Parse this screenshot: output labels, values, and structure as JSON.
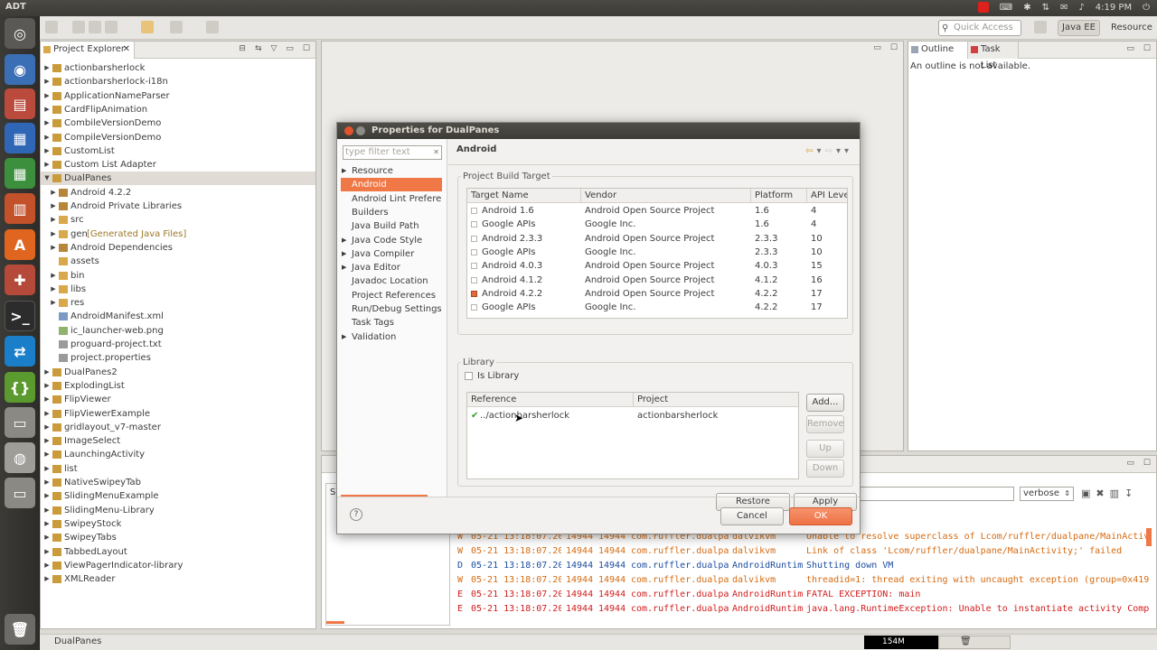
{
  "system": {
    "title": "ADT",
    "clock": "4:19 PM"
  },
  "toolbar": {
    "quick_access_placeholder": "Quick Access",
    "perspectives": [
      "Java EE",
      "Resource"
    ]
  },
  "project_explorer": {
    "title": "Project Explorer",
    "items": [
      {
        "label": "actionbarsherlock",
        "depth": 0,
        "expanded": false,
        "icon": "project-icon"
      },
      {
        "label": "actionbarsherlock-i18n",
        "depth": 0,
        "expanded": false,
        "icon": "project-icon"
      },
      {
        "label": "ApplicationNameParser",
        "depth": 0,
        "expanded": false,
        "icon": "project-icon"
      },
      {
        "label": "CardFlipAnimation",
        "depth": 0,
        "expanded": false,
        "icon": "project-icon"
      },
      {
        "label": "CombileVersionDemo",
        "depth": 0,
        "expanded": false,
        "icon": "project-icon"
      },
      {
        "label": "CompileVersionDemo",
        "depth": 0,
        "expanded": false,
        "icon": "project-icon"
      },
      {
        "label": "CustomList",
        "depth": 0,
        "expanded": false,
        "icon": "project-icon"
      },
      {
        "label": "Custom List Adapter",
        "depth": 0,
        "expanded": false,
        "icon": "project-icon"
      },
      {
        "label": "DualPanes",
        "depth": 0,
        "expanded": true,
        "icon": "project-icon",
        "selected": true
      },
      {
        "label": "Android 4.2.2",
        "depth": 1,
        "expanded": false,
        "icon": "library-icon"
      },
      {
        "label": "Android Private Libraries",
        "depth": 1,
        "expanded": false,
        "icon": "library-icon"
      },
      {
        "label": "src",
        "depth": 1,
        "expanded": false,
        "icon": "folder-icon"
      },
      {
        "label": "gen",
        "suffix": "[Generated Java Files]",
        "depth": 1,
        "expanded": false,
        "icon": "folder-icon"
      },
      {
        "label": "Android Dependencies",
        "depth": 1,
        "expanded": false,
        "icon": "library-icon"
      },
      {
        "label": "assets",
        "depth": 1,
        "expanded": null,
        "icon": "folder-icon"
      },
      {
        "label": "bin",
        "depth": 1,
        "expanded": false,
        "icon": "folder-icon"
      },
      {
        "label": "libs",
        "depth": 1,
        "expanded": false,
        "icon": "folder-icon"
      },
      {
        "label": "res",
        "depth": 1,
        "expanded": false,
        "icon": "folder-icon"
      },
      {
        "label": "AndroidManifest.xml",
        "depth": 1,
        "expanded": null,
        "icon": "xml-file-icon"
      },
      {
        "label": "ic_launcher-web.png",
        "depth": 1,
        "expanded": null,
        "icon": "image-file-icon"
      },
      {
        "label": "proguard-project.txt",
        "depth": 1,
        "expanded": null,
        "icon": "text-file-icon"
      },
      {
        "label": "project.properties",
        "depth": 1,
        "expanded": null,
        "icon": "text-file-icon"
      },
      {
        "label": "DualPanes2",
        "depth": 0,
        "expanded": false,
        "icon": "project-icon"
      },
      {
        "label": "ExplodingList",
        "depth": 0,
        "expanded": false,
        "icon": "project-icon"
      },
      {
        "label": "FlipViewer",
        "depth": 0,
        "expanded": false,
        "icon": "project-icon"
      },
      {
        "label": "FlipViewerExample",
        "depth": 0,
        "expanded": false,
        "icon": "project-icon"
      },
      {
        "label": "gridlayout_v7-master",
        "depth": 0,
        "expanded": false,
        "icon": "project-icon"
      },
      {
        "label": "ImageSelect",
        "depth": 0,
        "expanded": false,
        "icon": "project-icon"
      },
      {
        "label": "LaunchingActivity",
        "depth": 0,
        "expanded": false,
        "icon": "project-icon"
      },
      {
        "label": "list",
        "depth": 0,
        "expanded": false,
        "icon": "project-icon"
      },
      {
        "label": "NativeSwipeyTab",
        "depth": 0,
        "expanded": false,
        "icon": "project-icon"
      },
      {
        "label": "SlidingMenuExample",
        "depth": 0,
        "expanded": false,
        "icon": "project-icon"
      },
      {
        "label": "SlidingMenu-Library",
        "depth": 0,
        "expanded": false,
        "icon": "project-icon"
      },
      {
        "label": "SwipeyStock",
        "depth": 0,
        "expanded": false,
        "icon": "project-icon"
      },
      {
        "label": "SwipeyTabs",
        "depth": 0,
        "expanded": false,
        "icon": "project-icon"
      },
      {
        "label": "TabbedLayout",
        "depth": 0,
        "expanded": false,
        "icon": "project-icon"
      },
      {
        "label": "ViewPagerIndicator-library",
        "depth": 0,
        "expanded": false,
        "icon": "project-icon"
      },
      {
        "label": "XMLReader",
        "depth": 0,
        "expanded": false,
        "icon": "project-icon"
      }
    ]
  },
  "outline": {
    "tabs": [
      "Outline",
      "Task List"
    ],
    "message": "An outline is not available."
  },
  "logcat": {
    "level": "verbose",
    "rows": [
      {
        "level": "W",
        "time": "05-21 13:18:07.20",
        "pid": "14944",
        "tid": "14944",
        "app": "com.ruffler.dualpa",
        "tag": "dalvikvm",
        "text": "Unable to resolve superclass of Lcom/ruffler/dualpane/MainActiv"
      },
      {
        "level": "W",
        "time": "05-21 13:18:07.20",
        "pid": "14944",
        "tid": "14944",
        "app": "com.ruffler.dualpa",
        "tag": "dalvikvm",
        "text": "Link of class 'Lcom/ruffler/dualpane/MainActivity;' failed"
      },
      {
        "level": "D",
        "time": "05-21 13:18:07.20",
        "pid": "14944",
        "tid": "14944",
        "app": "com.ruffler.dualpa",
        "tag": "AndroidRuntim",
        "text": "Shutting down VM"
      },
      {
        "level": "W",
        "time": "05-21 13:18:07.20",
        "pid": "14944",
        "tid": "14944",
        "app": "com.ruffler.dualpa",
        "tag": "dalvikvm",
        "text": "threadid=1: thread exiting with uncaught exception (group=0x419"
      },
      {
        "level": "E",
        "time": "05-21 13:18:07.20",
        "pid": "14944",
        "tid": "14944",
        "app": "com.ruffler.dualpa",
        "tag": "AndroidRuntim",
        "text": "FATAL EXCEPTION: main"
      },
      {
        "level": "E",
        "time": "05-21 13:18:07.20",
        "pid": "14944",
        "tid": "14944",
        "app": "com.ruffler.dualpa",
        "tag": "AndroidRuntim",
        "text": "java.lang.RuntimeException: Unable to instantiate activity Comp"
      }
    ]
  },
  "status_bar": {
    "text": "DualPanes",
    "heap": "154M"
  },
  "dialog": {
    "title": "Properties for DualPanes",
    "filter_placeholder": "type filter text",
    "categories": [
      {
        "label": "Resource",
        "expandable": true
      },
      {
        "label": "Android",
        "expandable": false,
        "selected": true
      },
      {
        "label": "Android Lint Preferences",
        "expandable": false
      },
      {
        "label": "Builders",
        "expandable": false
      },
      {
        "label": "Java Build Path",
        "expandable": false
      },
      {
        "label": "Java Code Style",
        "expandable": true
      },
      {
        "label": "Java Compiler",
        "expandable": true
      },
      {
        "label": "Java Editor",
        "expandable": true
      },
      {
        "label": "Javadoc Location",
        "expandable": false
      },
      {
        "label": "Project References",
        "expandable": false
      },
      {
        "label": "Run/Debug Settings",
        "expandable": false
      },
      {
        "label": "Task Tags",
        "expandable": false
      },
      {
        "label": "Validation",
        "expandable": true
      }
    ],
    "page_title": "Android",
    "build_target": {
      "group_label": "Project Build Target",
      "columns": [
        "Target Name",
        "Vendor",
        "Platform",
        "API Leve"
      ],
      "rows": [
        {
          "name": "Android 1.6",
          "vendor": "Android Open Source Project",
          "platform": "1.6",
          "api": "4",
          "checked": false
        },
        {
          "name": "Google APIs",
          "vendor": "Google Inc.",
          "platform": "1.6",
          "api": "4",
          "checked": false
        },
        {
          "name": "Android 2.3.3",
          "vendor": "Android Open Source Project",
          "platform": "2.3.3",
          "api": "10",
          "checked": false
        },
        {
          "name": "Google APIs",
          "vendor": "Google Inc.",
          "platform": "2.3.3",
          "api": "10",
          "checked": false
        },
        {
          "name": "Android 4.0.3",
          "vendor": "Android Open Source Project",
          "platform": "4.0.3",
          "api": "15",
          "checked": false
        },
        {
          "name": "Android 4.1.2",
          "vendor": "Android Open Source Project",
          "platform": "4.1.2",
          "api": "16",
          "checked": false
        },
        {
          "name": "Android 4.2.2",
          "vendor": "Android Open Source Project",
          "platform": "4.2.2",
          "api": "17",
          "checked": true
        },
        {
          "name": "Google APIs",
          "vendor": "Google Inc.",
          "platform": "4.2.2",
          "api": "17",
          "checked": false
        }
      ]
    },
    "library": {
      "group_label": "Library",
      "is_library_label": "Is Library",
      "is_library_checked": false,
      "columns": [
        "Reference",
        "Project"
      ],
      "rows": [
        {
          "reference": "../actionbarsherlock",
          "project": "actionbarsherlock",
          "valid": true
        }
      ],
      "buttons": {
        "add": "Add...",
        "remove": "Remove",
        "up": "Up",
        "down": "Down"
      }
    },
    "buttons": {
      "restore": "Restore Defaults",
      "apply": "Apply",
      "cancel": "Cancel",
      "ok": "OK"
    }
  }
}
